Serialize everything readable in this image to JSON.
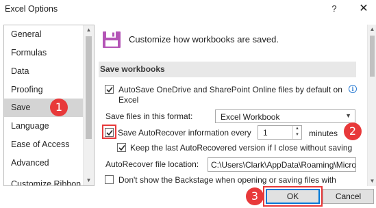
{
  "window": {
    "title": "Excel Options",
    "help_glyph": "?",
    "close_glyph": "✕"
  },
  "sidebar": {
    "items": [
      {
        "label": "General"
      },
      {
        "label": "Formulas"
      },
      {
        "label": "Data"
      },
      {
        "label": "Proofing"
      },
      {
        "label": "Save",
        "selected": true
      },
      {
        "label": "Language"
      },
      {
        "label": "Ease of Access"
      },
      {
        "label": "Advanced"
      },
      {
        "label": "Customize Ribbon"
      }
    ]
  },
  "main": {
    "header": "Customize how workbooks are saved.",
    "section_title": "Save workbooks",
    "autosave": {
      "label_line1": "AutoSave OneDrive and SharePoint Online files by default on",
      "label_line2": "Excel",
      "checked": true
    },
    "save_format": {
      "label": "Save files in this format:",
      "value": "Excel Workbook"
    },
    "autorecover": {
      "label": "Save AutoRecover information every",
      "value": "1",
      "unit": "minutes",
      "checked": true
    },
    "keep_last": {
      "label": "Keep the last AutoRecovered version if I close without saving",
      "checked": true
    },
    "location": {
      "label": "AutoRecover file location:",
      "value": "C:\\Users\\Clark\\AppData\\Roaming\\Micro"
    },
    "backstage": {
      "label": "Don't show the Backstage when opening or saving files with",
      "checked": false
    }
  },
  "annotations": {
    "badge1": "1",
    "badge2": "2",
    "badge3": "3",
    "color": "#e8393a"
  },
  "footer": {
    "ok_label": "OK",
    "cancel_label": "Cancel"
  }
}
